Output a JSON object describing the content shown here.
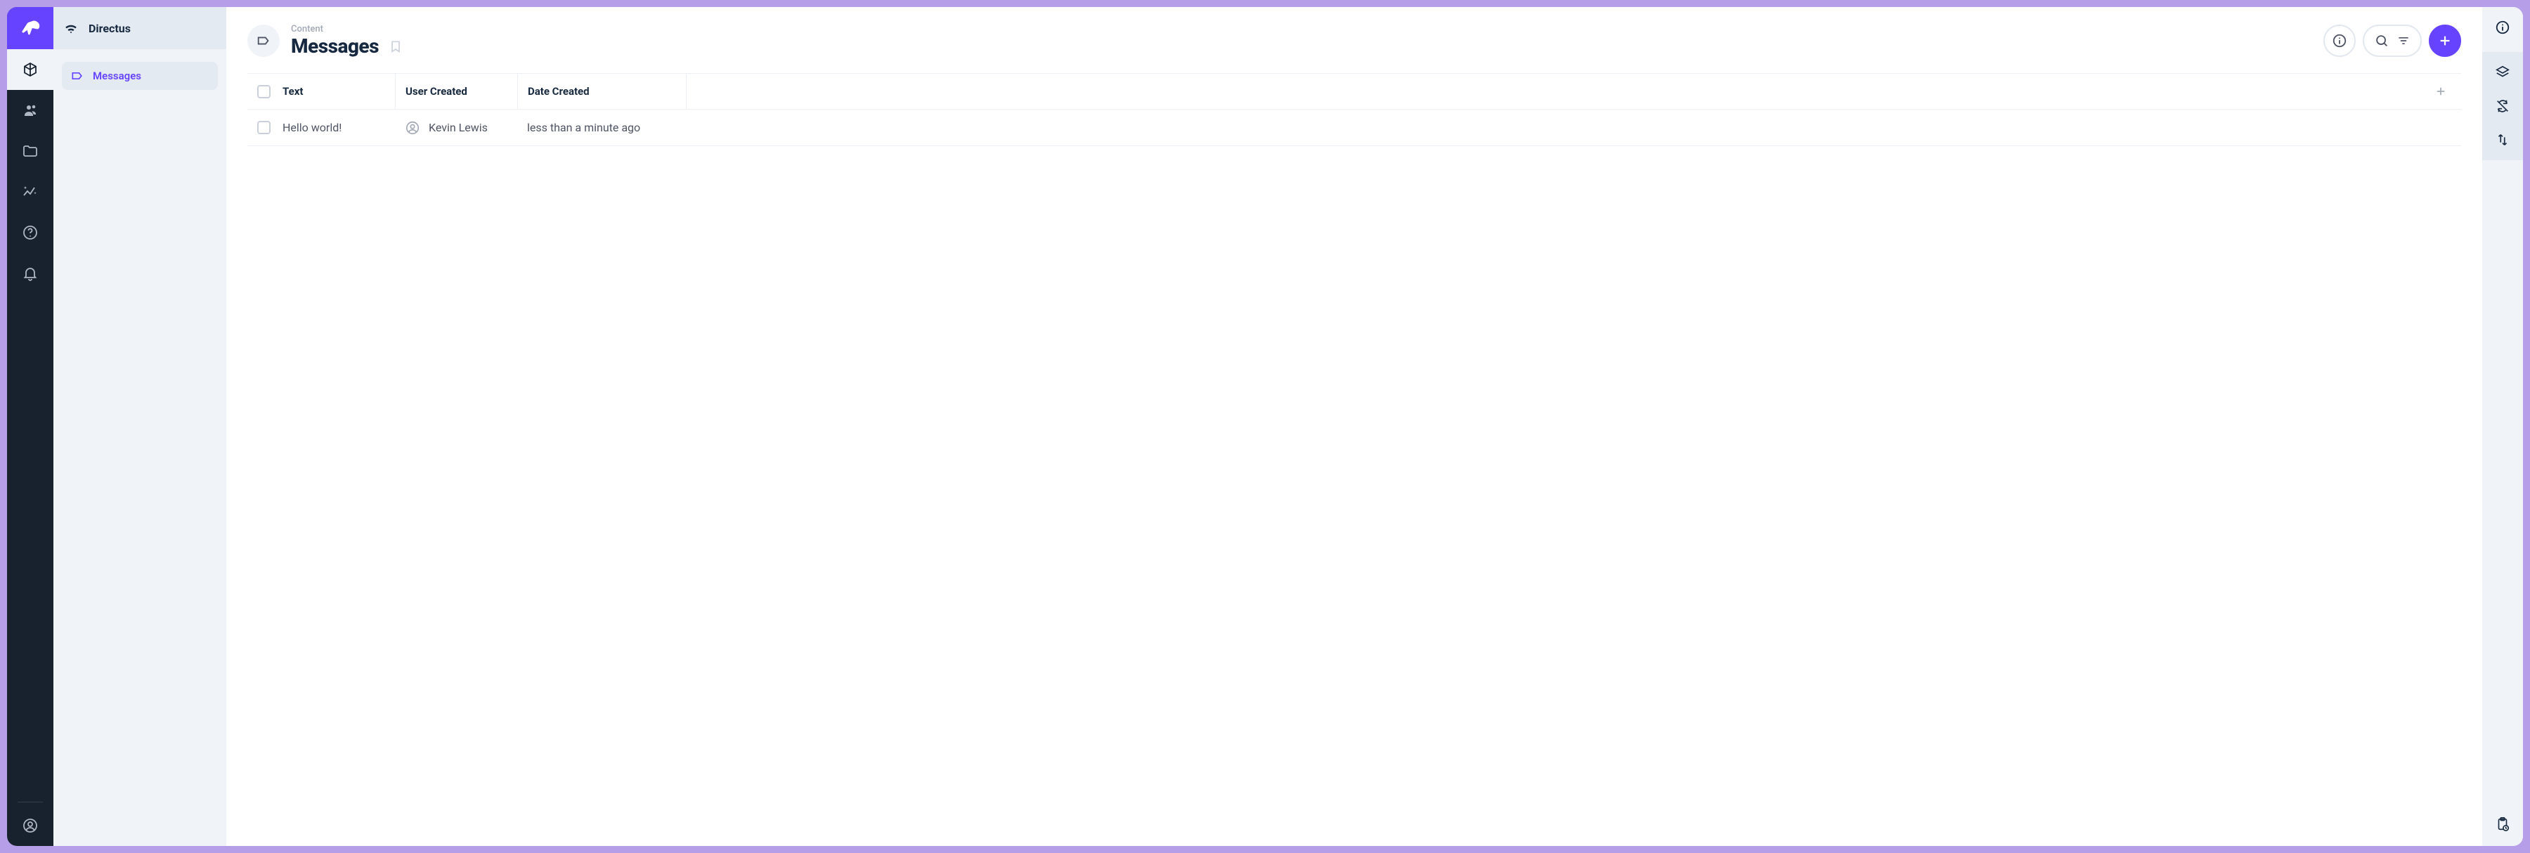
{
  "project": {
    "name": "Directus"
  },
  "sidebar": {
    "items": [
      {
        "label": "Messages"
      }
    ]
  },
  "header": {
    "breadcrumb": "Content",
    "title": "Messages"
  },
  "table": {
    "columns": [
      "Text",
      "User Created",
      "Date Created"
    ],
    "rows": [
      {
        "text": "Hello world!",
        "user": "Kevin Lewis",
        "date": "less than a minute ago"
      }
    ]
  }
}
